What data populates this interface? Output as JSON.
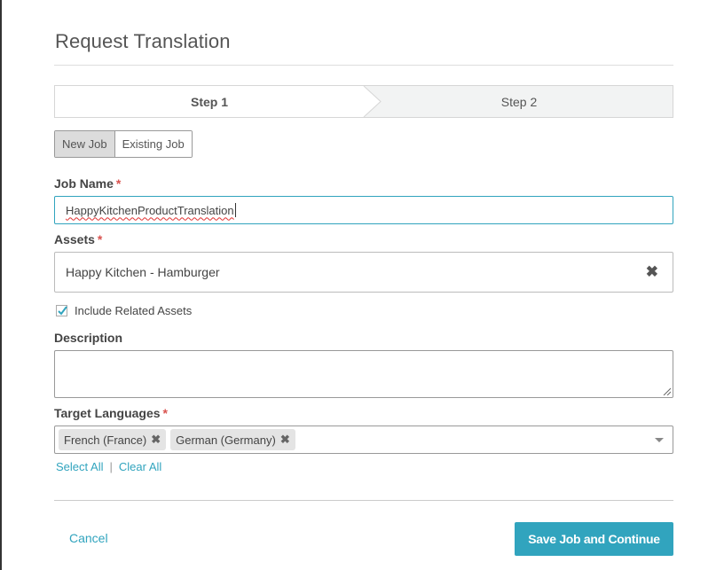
{
  "dialog": {
    "title": "Request Translation"
  },
  "steps": [
    {
      "label": "Step 1",
      "active": true
    },
    {
      "label": "Step 2",
      "active": false
    }
  ],
  "job_toggle": {
    "options": [
      "New Job",
      "Existing Job"
    ],
    "selected": "New Job"
  },
  "job_name": {
    "label": "Job Name",
    "required_mark": "*",
    "value": "HappyKitchenProductTranslation"
  },
  "assets": {
    "label": "Assets",
    "required_mark": "*",
    "value": "Happy Kitchen - Hamburger",
    "clear_icon": "close-icon"
  },
  "include_related": {
    "label": "Include Related Assets",
    "checked": true
  },
  "description": {
    "label": "Description",
    "value": ""
  },
  "target_languages": {
    "label": "Target Languages",
    "required_mark": "*",
    "selected": [
      "French (France)",
      "German (Germany)"
    ],
    "select_all_label": "Select All",
    "separator": "|",
    "clear_all_label": "Clear All"
  },
  "footer": {
    "cancel_label": "Cancel",
    "save_label": "Save Job and Continue"
  },
  "colors": {
    "accent": "#31a4be",
    "required": "#d9534f"
  }
}
